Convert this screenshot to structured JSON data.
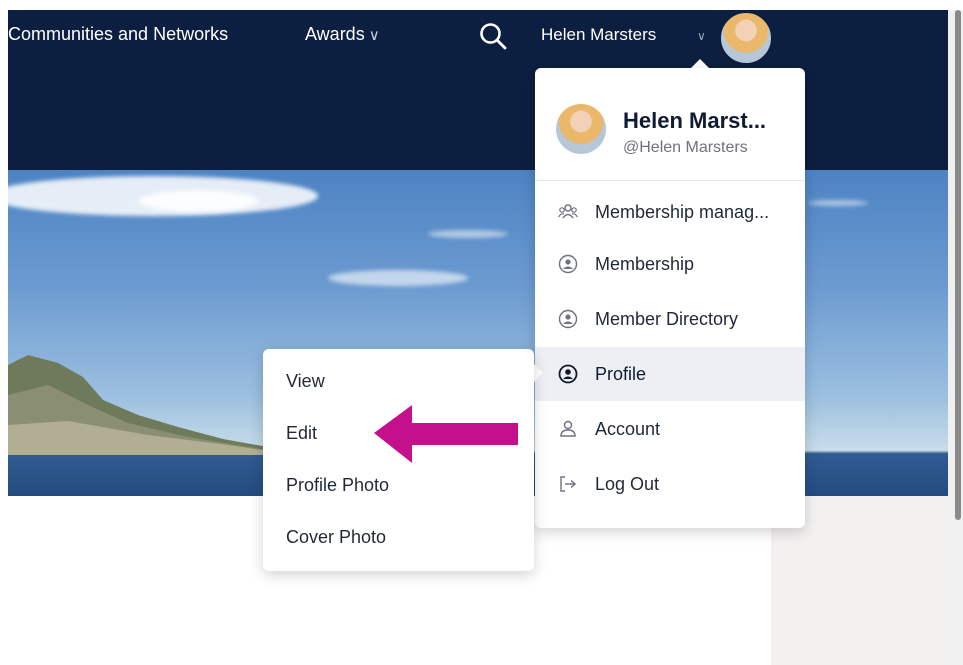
{
  "nav": {
    "communities_label": "Communities and Networks",
    "awards_label": "Awards",
    "awards_chevron": "∨",
    "user_name": "Helen Marsters",
    "user_chevron": "∨"
  },
  "dropdown": {
    "name": "Helen Marst...",
    "handle": "@Helen Marsters",
    "items": [
      {
        "label": "Membership manag...",
        "icon": "users-icon"
      },
      {
        "label": "Membership",
        "icon": "user-circle-icon"
      },
      {
        "label": "Member Directory",
        "icon": "user-circle-icon"
      },
      {
        "label": "Profile",
        "icon": "user-circle-icon",
        "active": true
      },
      {
        "label": "Account",
        "icon": "user-icon"
      },
      {
        "label": "Log Out",
        "icon": "logout-icon"
      }
    ]
  },
  "submenu": {
    "items": [
      {
        "label": "View"
      },
      {
        "label": "Edit"
      },
      {
        "label": "Profile Photo"
      },
      {
        "label": "Cover Photo"
      }
    ]
  },
  "colors": {
    "navbar": "#0c1f40",
    "annotation_arrow": "#c4108c",
    "active_item_bg": "#eeeff4"
  }
}
